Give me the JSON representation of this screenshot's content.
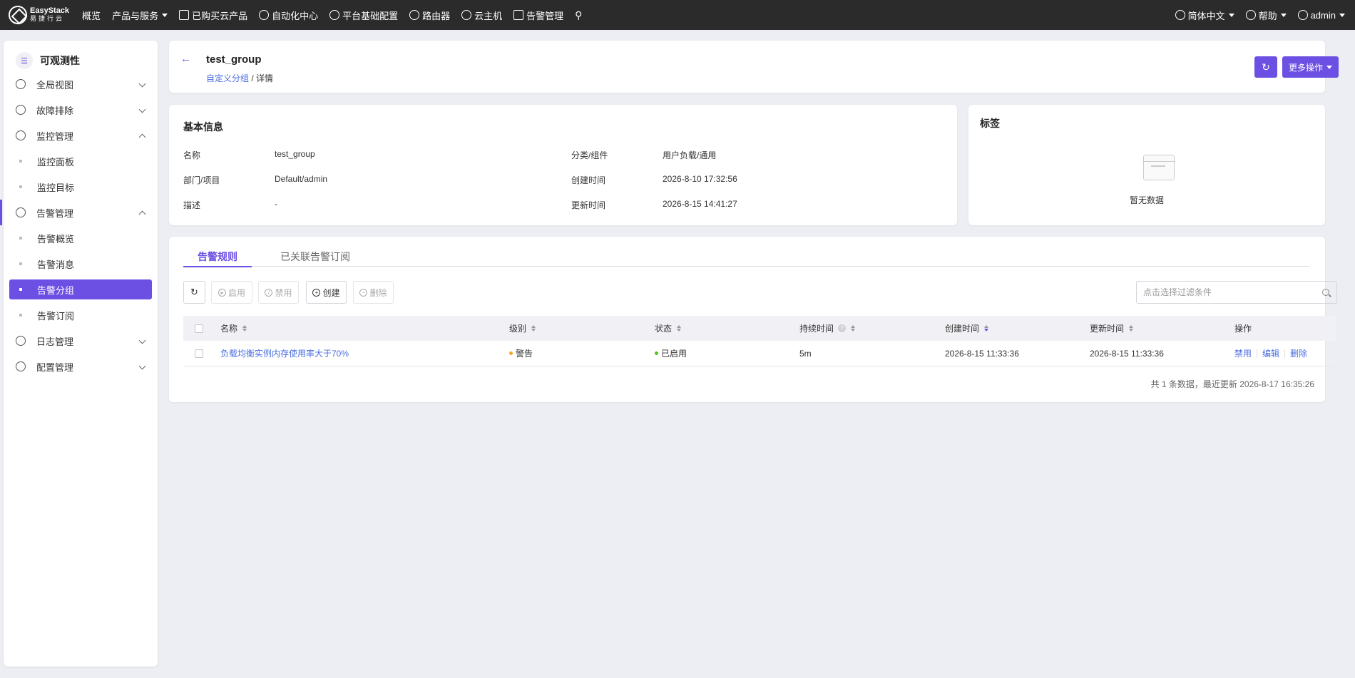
{
  "topnav": {
    "logo": {
      "en": "EasyStack",
      "cn": "易捷行云"
    },
    "items": [
      {
        "label": "概览",
        "icon": "",
        "dropdown": false
      },
      {
        "label": "产品与服务",
        "icon": "",
        "dropdown": true
      },
      {
        "label": "已购买云产品",
        "icon": "list-icon",
        "dropdown": false
      },
      {
        "label": "自动化中心",
        "icon": "gauge-icon",
        "dropdown": false
      },
      {
        "label": "平台基础配置",
        "icon": "gear-icon",
        "dropdown": false
      },
      {
        "label": "路由器",
        "icon": "router-icon",
        "dropdown": false
      },
      {
        "label": "云主机",
        "icon": "cloud-icon",
        "dropdown": false
      },
      {
        "label": "告警管理",
        "icon": "alarm-icon",
        "dropdown": false
      }
    ],
    "language": "简体中文",
    "help": "帮助",
    "user": "admin"
  },
  "sidebar": {
    "title": "可观测性",
    "items": [
      {
        "label": "全局视图"
      },
      {
        "label": "故障排除"
      },
      {
        "label": "监控管理",
        "children": [
          "监控面板",
          "监控目标"
        ]
      },
      {
        "label": "告警管理",
        "children": [
          "告警概览",
          "告警消息",
          "告警分组",
          "告警订阅"
        ]
      },
      {
        "label": "日志管理"
      },
      {
        "label": "配置管理"
      }
    ]
  },
  "header": {
    "title": "test_group",
    "breadcrumb_link": "自定义分组",
    "breadcrumb_sep": " / ",
    "breadcrumb_current": "详情",
    "more_label": "更多操作"
  },
  "basic_info": {
    "title": "基本信息",
    "fields": [
      {
        "key": "名称",
        "value": "test_group"
      },
      {
        "key": "部门/项目",
        "value": "Default/admin"
      },
      {
        "key": "描述",
        "value": "-"
      },
      {
        "key": "分类/组件",
        "value": "用户负载/通用"
      },
      {
        "key": "创建时间",
        "value": "2026-8-10 17:32:56"
      },
      {
        "key": "更新时间",
        "value": "2026-8-15 14:41:27"
      }
    ]
  },
  "tags": {
    "title": "标签",
    "empty": "暂无数据"
  },
  "rules": {
    "tabs": [
      "告警规则",
      "已关联告警订阅"
    ],
    "toolbar": {
      "enable": "启用",
      "disable": "禁用",
      "create": "创建",
      "delete": "删除"
    },
    "search_placeholder": "点击选择过滤条件",
    "columns": [
      "名称",
      "级别",
      "状态",
      "持续时间",
      "创建时间",
      "更新时间",
      "操作"
    ],
    "rows": [
      {
        "name": "负载均衡实例内存使用率大于70%",
        "level": "警告",
        "level_color": "#f5a623",
        "status": "已启用",
        "status_color": "#52c41a",
        "duration": "5m",
        "created": "2026-8-15 11:33:36",
        "updated": "2026-8-15 11:33:36",
        "actions": [
          "禁用",
          "编辑",
          "删除"
        ]
      }
    ],
    "footer": "共 1 条数据，最近更新  2026-8-17 16:35:26"
  },
  "colors": {
    "accent": "#6c4fe3",
    "link": "#4a6ee0",
    "topbar": "#2b2b2b"
  }
}
